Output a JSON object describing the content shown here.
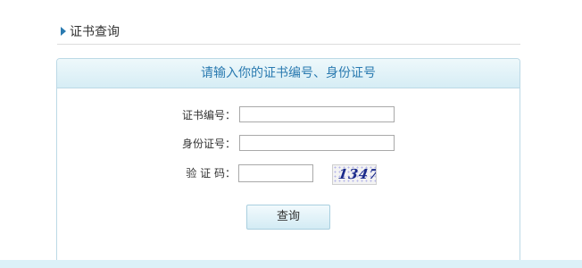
{
  "section": {
    "title": "证书查询"
  },
  "panel": {
    "header": "请输入你的证书编号、身份证号"
  },
  "form": {
    "certificate_label": "证书编号：",
    "id_label": "身份证号：",
    "captcha_label": "验 证 码：",
    "certificate_value": "",
    "id_value": "",
    "captcha_value": ""
  },
  "captcha": {
    "text": "1347"
  },
  "actions": {
    "query_label": "查询"
  },
  "colors": {
    "accent": "#2a7ab0",
    "panel_border": "#bcd9e6",
    "bottom_band": "#dcf1f8"
  }
}
